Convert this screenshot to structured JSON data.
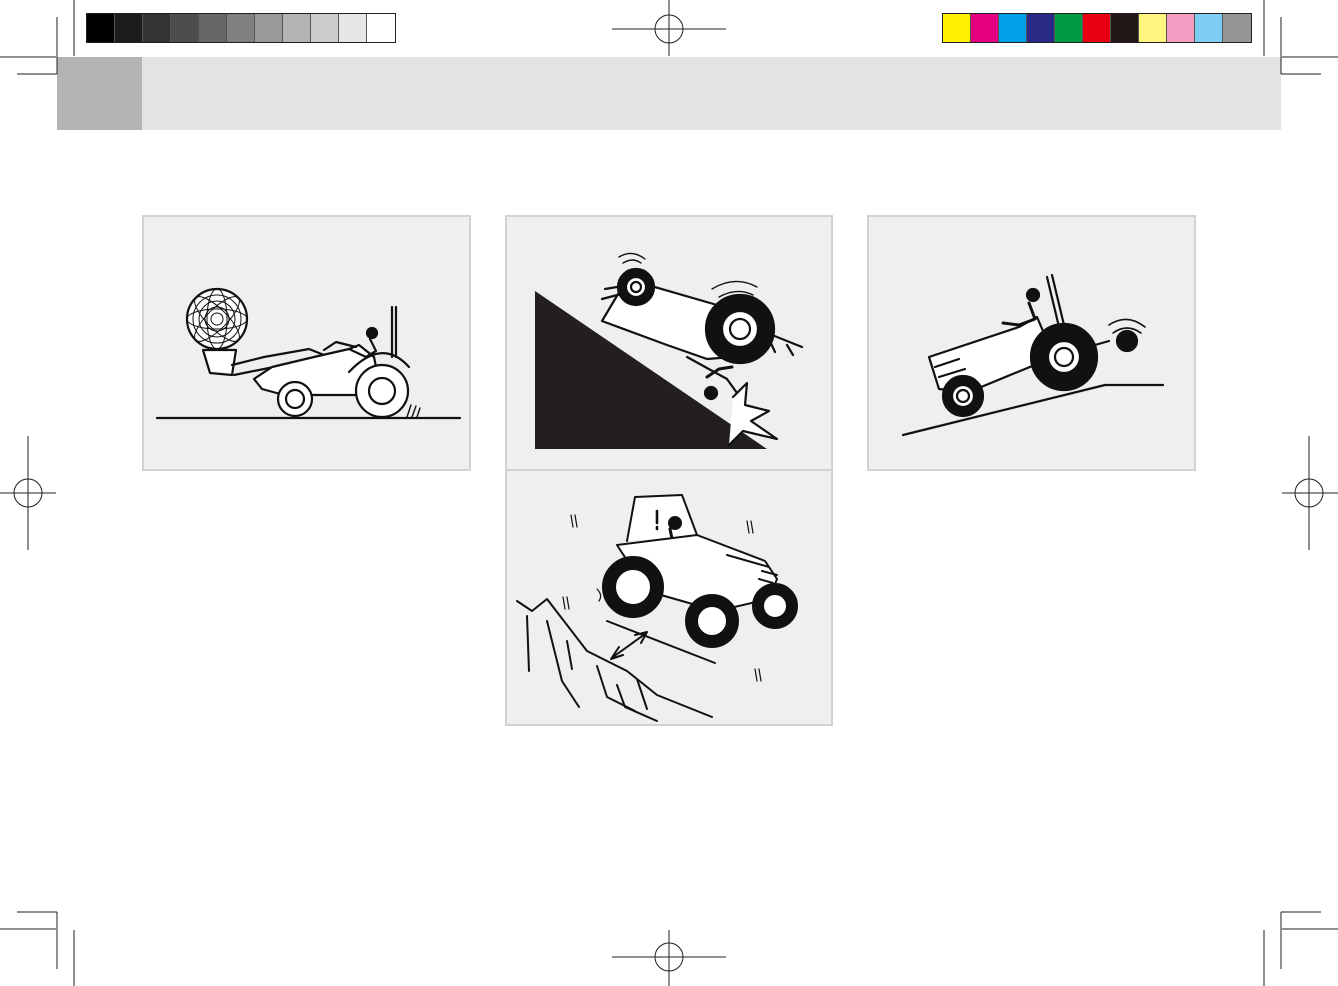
{
  "color_bars": {
    "grayscale": [
      "#000000",
      "#1c1c1c",
      "#333333",
      "#4d4d4d",
      "#666666",
      "#808080",
      "#999999",
      "#b3b3b3",
      "#cccccc",
      "#e6e6e6",
      "#ffffff"
    ],
    "process": [
      "#fff100",
      "#e5007f",
      "#00a0e9",
      "#2a2a86",
      "#009944",
      "#e60012",
      "#231815",
      "#fff57f",
      "#f29ec2",
      "#7ecef4",
      "#969696"
    ]
  },
  "header": {
    "band_color": "#e3e3e3",
    "tab_color": "#b3b3b3"
  },
  "panels": [
    {
      "id": "loader-bale",
      "icon": "tractor-front-loader-raised-bale-icon"
    },
    {
      "id": "slope-rollover",
      "icon": "tractor-sideways-rollover-on-slope-icon"
    },
    {
      "id": "uphill-backflip",
      "icon": "tractor-rear-overturn-uphill-icon"
    },
    {
      "id": "embankment-edge",
      "icon": "tractor-near-embankment-edge-icon"
    }
  ]
}
